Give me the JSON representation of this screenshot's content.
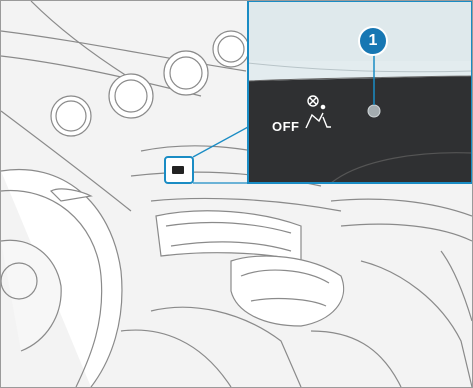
{
  "figure": {
    "callout_number": "1",
    "indicator_label": "OFF",
    "indicator_symbol": "passenger-airbag-off-icon",
    "colors": {
      "accent": "#1a8cc4",
      "callout_fill": "#1777b3",
      "panel_dark": "#2f3032",
      "line_art": "#8a8a8a"
    }
  }
}
